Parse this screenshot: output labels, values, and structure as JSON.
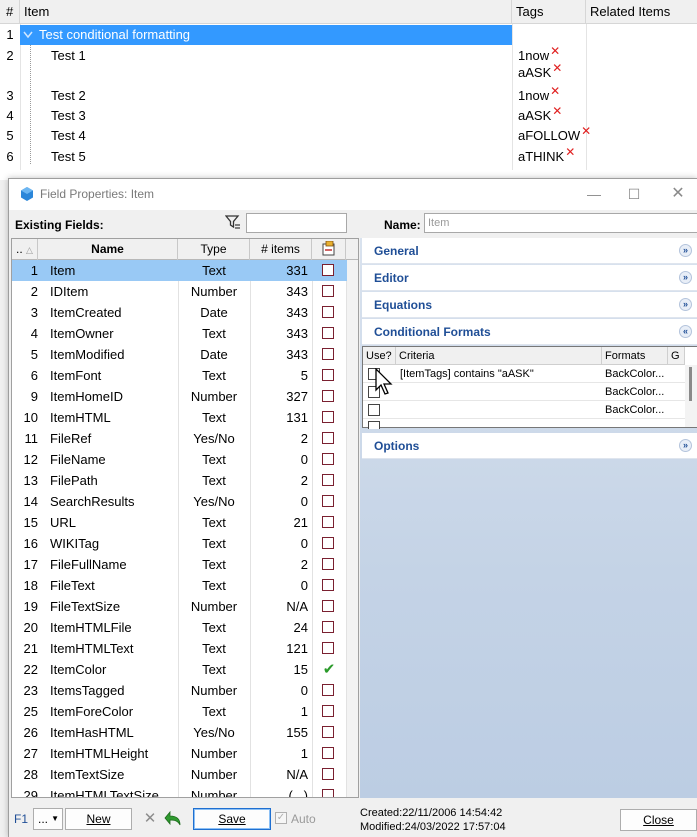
{
  "grid": {
    "columns": {
      "num": "#",
      "item": "Item",
      "tags": "Tags",
      "related": "Related Items"
    },
    "rows": [
      {
        "num": "1",
        "item": "Test conditional formatting",
        "tags": [],
        "selected": true
      },
      {
        "num": "2",
        "item": "Test 1",
        "tags": [
          "1now",
          "aASK"
        ]
      },
      {
        "num": "3",
        "item": "Test 2",
        "tags": [
          "1now"
        ]
      },
      {
        "num": "4",
        "item": "Test 3",
        "tags": [
          "aASK"
        ]
      },
      {
        "num": "5",
        "item": "Test 4",
        "tags": [
          "aFOLLOW"
        ]
      },
      {
        "num": "6",
        "item": "Test 5",
        "tags": [
          "aTHINK"
        ]
      }
    ],
    "tag_remove_icon": "close-icon",
    "tag_remove_color": "#e02020",
    "selection_color": "#3399ff"
  },
  "dialog": {
    "title": "Field Properties: Item",
    "existing_fields_label": "Existing Fields:",
    "filter_icon": "filter-icon",
    "filter_value": "",
    "name_label": "Name:",
    "name_placeholder": "Item",
    "table": {
      "headers": {
        "sort": "..",
        "name": "Name",
        "type": "Type",
        "items": "# items",
        "flag": "flag-icon"
      },
      "rows": [
        {
          "num": "1",
          "name": "Item",
          "type": "Text",
          "count": "331",
          "checked": false,
          "selected": true
        },
        {
          "num": "2",
          "name": "IDItem",
          "type": "Number",
          "count": "343",
          "checked": false
        },
        {
          "num": "3",
          "name": "ItemCreated",
          "type": "Date",
          "count": "343",
          "checked": false
        },
        {
          "num": "4",
          "name": "ItemOwner",
          "type": "Text",
          "count": "343",
          "checked": false
        },
        {
          "num": "5",
          "name": "ItemModified",
          "type": "Date",
          "count": "343",
          "checked": false
        },
        {
          "num": "6",
          "name": "ItemFont",
          "type": "Text",
          "count": "5",
          "checked": false
        },
        {
          "num": "9",
          "name": "ItemHomeID",
          "type": "Number",
          "count": "327",
          "checked": false
        },
        {
          "num": "10",
          "name": "ItemHTML",
          "type": "Text",
          "count": "131",
          "checked": false
        },
        {
          "num": "11",
          "name": "FileRef",
          "type": "Yes/No",
          "count": "2",
          "checked": false
        },
        {
          "num": "12",
          "name": "FileName",
          "type": "Text",
          "count": "0",
          "checked": false
        },
        {
          "num": "13",
          "name": "FilePath",
          "type": "Text",
          "count": "2",
          "checked": false
        },
        {
          "num": "14",
          "name": "SearchResults",
          "type": "Yes/No",
          "count": "0",
          "checked": false
        },
        {
          "num": "15",
          "name": "URL",
          "type": "Text",
          "count": "21",
          "checked": false
        },
        {
          "num": "16",
          "name": "WIKITag",
          "type": "Text",
          "count": "0",
          "checked": false
        },
        {
          "num": "17",
          "name": "FileFullName",
          "type": "Text",
          "count": "2",
          "checked": false
        },
        {
          "num": "18",
          "name": "FileText",
          "type": "Text",
          "count": "0",
          "checked": false
        },
        {
          "num": "19",
          "name": "FileTextSize",
          "type": "Number",
          "count": "N/A",
          "checked": false
        },
        {
          "num": "20",
          "name": "ItemHTMLFile",
          "type": "Text",
          "count": "24",
          "checked": false
        },
        {
          "num": "21",
          "name": "ItemHTMLText",
          "type": "Text",
          "count": "121",
          "checked": false
        },
        {
          "num": "22",
          "name": "ItemColor",
          "type": "Text",
          "count": "15",
          "checked": true
        },
        {
          "num": "23",
          "name": "ItemsTagged",
          "type": "Number",
          "count": "0",
          "checked": false
        },
        {
          "num": "25",
          "name": "ItemForeColor",
          "type": "Text",
          "count": "1",
          "checked": false
        },
        {
          "num": "26",
          "name": "ItemHasHTML",
          "type": "Yes/No",
          "count": "155",
          "checked": false
        },
        {
          "num": "27",
          "name": "ItemHTMLHeight",
          "type": "Number",
          "count": "1",
          "checked": false
        },
        {
          "num": "28",
          "name": "ItemTextSize",
          "type": "Number",
          "count": "N/A",
          "checked": false
        },
        {
          "num": "29",
          "name": "ItemHTMLTextSize",
          "type": "Number",
          "count": "(...)",
          "checked": false
        }
      ]
    },
    "sections": {
      "general": "General",
      "editor": "Editor",
      "equations": "Equations",
      "conditional_formats": "Conditional Formats",
      "options": "Options"
    },
    "conditional_formats": {
      "headers": {
        "use": "Use?",
        "criteria": "Criteria",
        "formats": "Formats",
        "g": "G"
      },
      "rows": [
        {
          "use": false,
          "criteria": "[ItemTags] contains \"aASK\"",
          "formats": "BackColor..."
        },
        {
          "use": false,
          "criteria": "",
          "formats": "BackColor..."
        },
        {
          "use": false,
          "criteria": "",
          "formats": "BackColor..."
        }
      ]
    },
    "bottom": {
      "f1": "F1",
      "dots": "...",
      "new": "New",
      "save": "Save",
      "auto": "Auto",
      "created": "Created:22/11/2006 14:54:42",
      "modified": "Modified:24/03/2022 17:57:04",
      "close": "Close"
    }
  }
}
